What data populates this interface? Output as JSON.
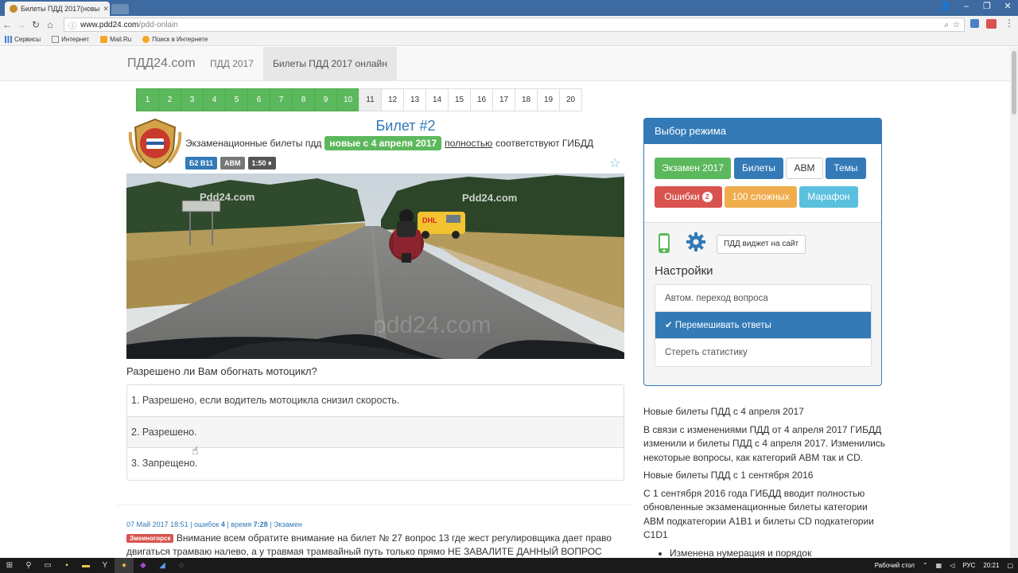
{
  "browser": {
    "tab_title": "Билеты ПДД 2017(новы",
    "url_host": "www.pdd24.com",
    "url_path": "/pdd-onlain",
    "bookmarks": [
      "Сервисы",
      "Интернет",
      "Mail.Ru",
      "Поиск в Интернете"
    ]
  },
  "header": {
    "brand": "ПДД24.com",
    "nav": [
      "ПДД 2017",
      "Билеты ПДД 2017 онлайн"
    ]
  },
  "pager": {
    "pages": [
      "1",
      "2",
      "3",
      "4",
      "5",
      "6",
      "7",
      "8",
      "9",
      "10",
      "11",
      "12",
      "13",
      "14",
      "15",
      "16",
      "17",
      "18",
      "19",
      "20"
    ],
    "answered_count": 10,
    "current": "11"
  },
  "ticket": {
    "title": "Билет #2",
    "subtitle_pre": "Экзаменационные билеты пдд",
    "subtitle_label": "новые с 4 апреля 2017",
    "subtitle_link": "полностью",
    "subtitle_post": "соответствуют ГИБДД",
    "badges": [
      "Б2 В11",
      "ABM",
      "1:50 ⏸"
    ],
    "watermarks": [
      "Pdd24.com",
      "Pdd24.com",
      "pdd24.com"
    ],
    "truck_text": "DHL",
    "question": "Разрешено ли Вам обогнать мотоцикл?",
    "answers": [
      "1. Разрешено, если водитель мотоцикла снизил скорость.",
      "2. Разрешено.",
      "3. Запрещено."
    ]
  },
  "comment": {
    "date": "07 Май 2017 18:51",
    "sep": " | ",
    "errors_label": "ошибок",
    "errors": "4",
    "time_label": "время",
    "time": "7:28",
    "mode": "Экзамен",
    "city": "Змеиногорск",
    "text": "Внимание всем обратите внимание на билет № 27 вопрос 13 где жест регулировщика дает право двигаться трамваю налево, а у травмая трамвайный путь только прямо НЕ ЗАВАЛИТЕ ДАННЫЙ ВОПРОС"
  },
  "panel": {
    "title": "Выбор режима",
    "modes": {
      "exam": "Экзамен 2017",
      "tickets": "Билеты",
      "abm": "ABM",
      "topics": "Темы",
      "errors": "Ошибки",
      "errors_count": "2",
      "hard": "100 сложных",
      "marathon": "Марафон"
    },
    "widget": "ПДД виджет на сайт",
    "settings_title": "Настройки",
    "settings": [
      "Автом. переход вопроса",
      "Перемешивать ответы",
      "Стереть статистику"
    ],
    "active_setting_index": 1
  },
  "news": {
    "h1": "Новые билеты ПДД с 4 апреля 2017",
    "p1": "В связи с изменениями ПДД от 4 апреля 2017 ГИБДД изменили и билеты ПДД с 4 апреля 2017. Изменились некоторые вопросы, как категорий ABM так и CD.",
    "h2": "Новые билеты ПДД с 1 сентября 2016",
    "p2": "С 1 сентября 2016 года ГИБДД вводит полностью обновленные экзаменационные билеты категории ABM подкатегории A1B1 и билеты CD подкатегории C1D1",
    "li1": "Изменена нумерация и порядок"
  },
  "taskbar": {
    "desktop": "Рабочий стол",
    "lang": "РУС",
    "clock": "20:21"
  },
  "colors": {
    "primary": "#337ab7",
    "success": "#5cb85c",
    "danger": "#d9534f",
    "warning": "#f0ad4e",
    "info": "#5bc0de"
  }
}
